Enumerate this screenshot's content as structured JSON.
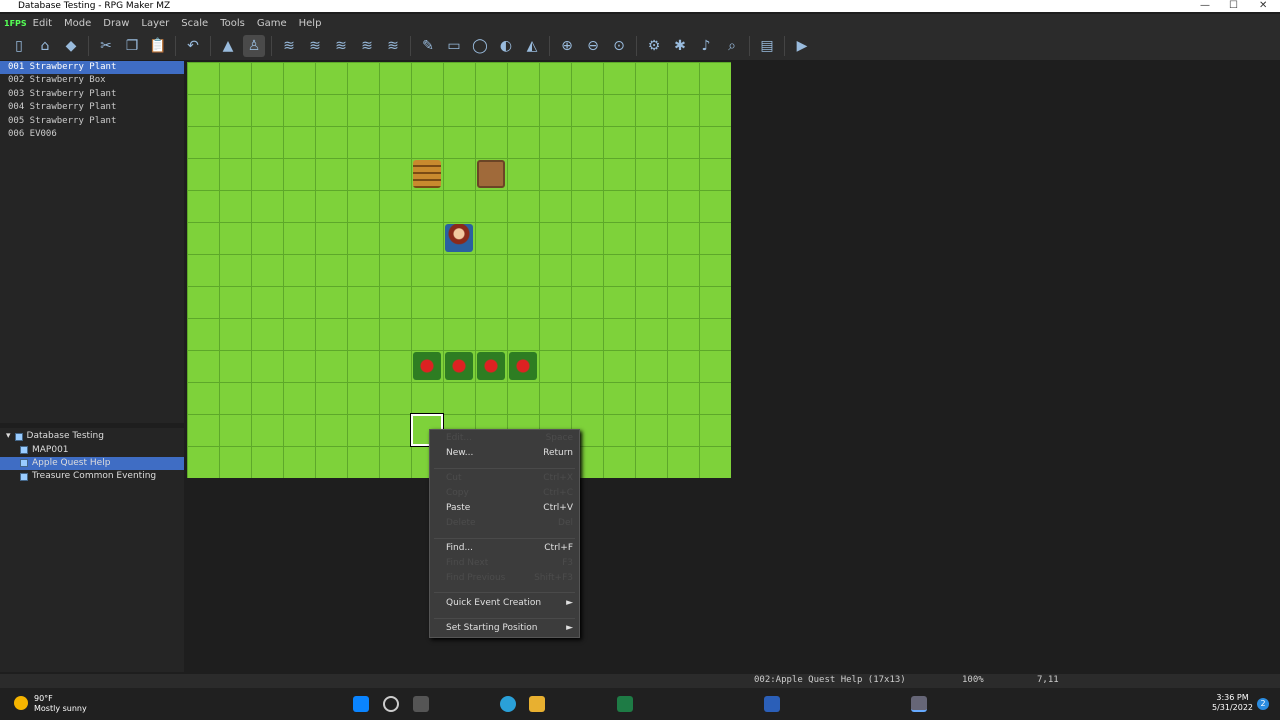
{
  "window": {
    "title": "Database Testing - RPG Maker MZ",
    "minimize": "—",
    "maximize": "☐",
    "close": "✕"
  },
  "menubar": {
    "fps": "1FPS",
    "items": [
      "Edit",
      "Mode",
      "Draw",
      "Layer",
      "Scale",
      "Tools",
      "Game",
      "Help"
    ]
  },
  "toolbar": {
    "buttons": [
      "new-project",
      "open-project",
      "save-project",
      "cut",
      "copy",
      "paste",
      "undo",
      "map-mode",
      "event-mode",
      "layer-1",
      "layer-2",
      "layer-3",
      "layer-4",
      "layer-all",
      "pencil",
      "rectangle",
      "ellipse",
      "fill",
      "shadow-pen",
      "zoom-in",
      "zoom-out",
      "actual-size",
      "database",
      "plugin-manager",
      "sound-test",
      "event-searcher",
      "resource-manager",
      "playtest"
    ],
    "active": "event-mode"
  },
  "events": [
    {
      "label": "001 Strawberry Plant",
      "selected": true
    },
    {
      "label": "002 Strawberry Box"
    },
    {
      "label": "003 Strawberry Plant"
    },
    {
      "label": "004 Strawberry Plant"
    },
    {
      "label": "005 Strawberry Plant"
    },
    {
      "label": "006 EV006"
    }
  ],
  "maps": [
    {
      "label": "Database Testing",
      "root": true
    },
    {
      "label": "MAP001"
    },
    {
      "label": "Apple Quest Help",
      "selected": true
    },
    {
      "label": "Treasure Common Eventing"
    }
  ],
  "context_menu": {
    "items": [
      {
        "label": "Edit...",
        "shortcut": "Space",
        "enabled": false
      },
      {
        "label": "New...",
        "shortcut": "Return",
        "enabled": true
      },
      {
        "label": "Cut",
        "shortcut": "Ctrl+X",
        "enabled": false
      },
      {
        "label": "Copy",
        "shortcut": "Ctrl+C",
        "enabled": false
      },
      {
        "label": "Paste",
        "shortcut": "Ctrl+V",
        "enabled": true
      },
      {
        "label": "Delete",
        "shortcut": "Del",
        "enabled": false
      },
      {
        "label": "Find...",
        "shortcut": "Ctrl+F",
        "enabled": true
      },
      {
        "label": "Find Next",
        "shortcut": "F3",
        "enabled": false
      },
      {
        "label": "Find Previous",
        "shortcut": "Shift+F3",
        "enabled": false
      },
      {
        "label": "Quick Event Creation",
        "shortcut": "►",
        "enabled": true
      },
      {
        "label": "Set Starting Position",
        "shortcut": "►",
        "enabled": true
      }
    ]
  },
  "status": {
    "map": "002:Apple Quest Help (17x13)",
    "zoom": "100%",
    "coords": "7,11"
  },
  "taskbar": {
    "weather_temp": "90°F",
    "weather_desc": "Mostly sunny",
    "time": "3:36 PM",
    "date": "5/31/2022",
    "notifications": "2"
  }
}
